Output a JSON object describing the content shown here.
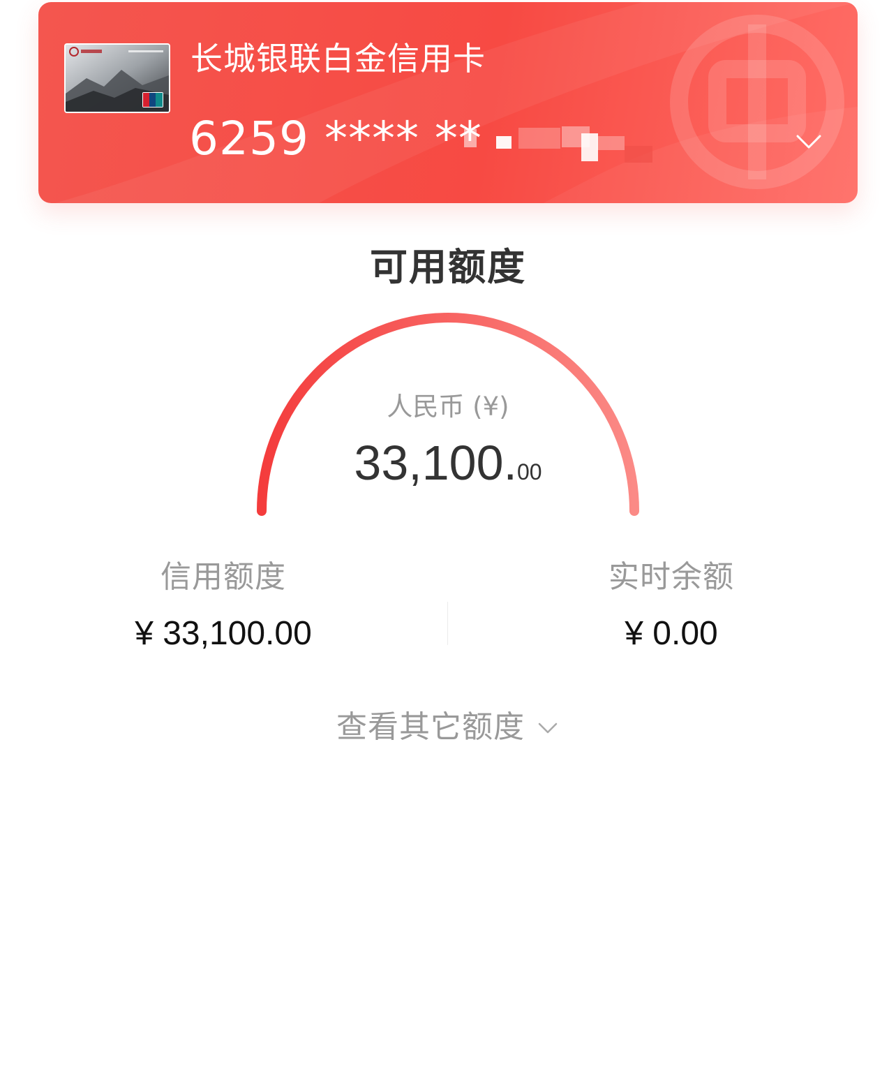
{
  "card": {
    "name": "长城银联白金信用卡",
    "number_masked": "6259 **** **"
  },
  "available_credit": {
    "title": "可用额度",
    "currency_label": "人民币 (¥)",
    "amount_integer": "33,100.",
    "amount_decimal": "00"
  },
  "stats": {
    "credit_limit_label": "信用额度",
    "credit_limit_value": "¥ 33,100.00",
    "realtime_balance_label": "实时余额",
    "realtime_balance_value": "¥ 0.00"
  },
  "view_other": {
    "label": "查看其它额度"
  },
  "colors": {
    "brand_red": "#f74a43",
    "gauge_start": "#f43c3c",
    "gauge_end": "#fb8a86",
    "muted_text": "#999999",
    "title_text": "#333333"
  },
  "icons": {
    "card_selector": "chevron-down-icon",
    "view_other": "chevron-down-icon",
    "watermark": "bank-of-china-logo"
  }
}
